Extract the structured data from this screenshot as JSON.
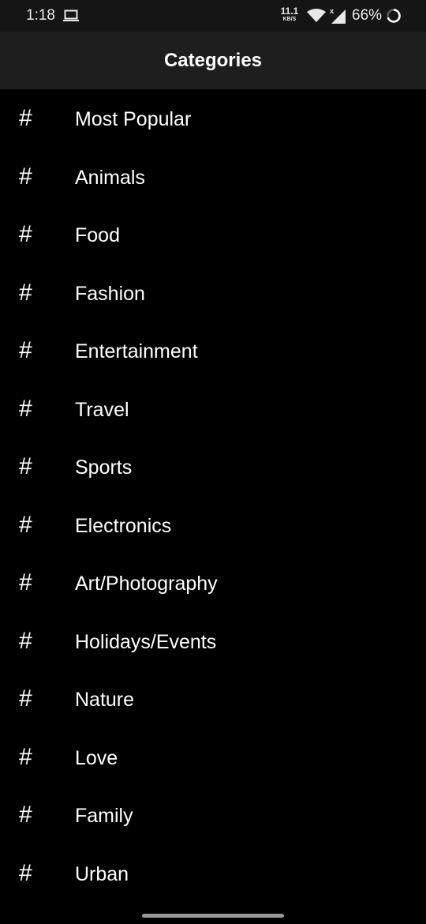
{
  "status_bar": {
    "time": "1:18",
    "net_speed_value": "11.1",
    "net_speed_unit": "KB/S",
    "battery": "66%"
  },
  "app_bar": {
    "title": "Categories"
  },
  "categories": [
    {
      "icon": "#",
      "label": "Most Popular"
    },
    {
      "icon": "#",
      "label": "Animals"
    },
    {
      "icon": "#",
      "label": "Food"
    },
    {
      "icon": "#",
      "label": "Fashion"
    },
    {
      "icon": "#",
      "label": "Entertainment"
    },
    {
      "icon": "#",
      "label": "Travel"
    },
    {
      "icon": "#",
      "label": "Sports"
    },
    {
      "icon": "#",
      "label": "Electronics"
    },
    {
      "icon": "#",
      "label": "Art/Photography"
    },
    {
      "icon": "#",
      "label": "Holidays/Events"
    },
    {
      "icon": "#",
      "label": "Nature"
    },
    {
      "icon": "#",
      "label": "Love"
    },
    {
      "icon": "#",
      "label": "Family"
    },
    {
      "icon": "#",
      "label": "Urban"
    }
  ],
  "colors": {
    "background": "#000000",
    "app_bar": "#1e1e1e",
    "status_bar": "#151515",
    "text": "#ffffff"
  }
}
